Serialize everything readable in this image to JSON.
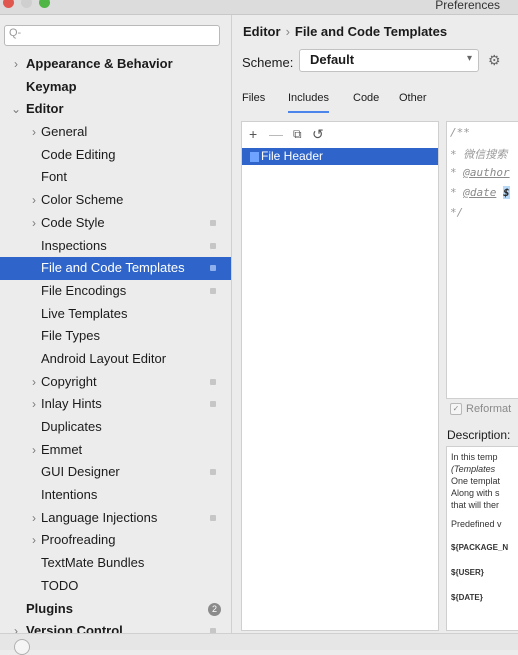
{
  "window": {
    "title": "Preferences"
  },
  "search": {
    "placeholder": "Q-"
  },
  "tree": [
    {
      "label": "Appearance & Behavior",
      "bold": true,
      "arrow": "›",
      "indent": 0
    },
    {
      "label": "Keymap",
      "bold": true,
      "arrow": "",
      "indent": 0
    },
    {
      "label": "Editor",
      "bold": true,
      "arrow": "⌄",
      "indent": 0
    },
    {
      "label": "General",
      "arrow": "›",
      "indent": 1
    },
    {
      "label": "Code Editing",
      "arrow": "",
      "indent": 1
    },
    {
      "label": "Font",
      "arrow": "",
      "indent": 1
    },
    {
      "label": "Color Scheme",
      "arrow": "›",
      "indent": 1
    },
    {
      "label": "Code Style",
      "arrow": "›",
      "indent": 1,
      "project": true
    },
    {
      "label": "Inspections",
      "arrow": "",
      "indent": 1,
      "project": true
    },
    {
      "label": "File and Code Templates",
      "arrow": "",
      "indent": 1,
      "project": true,
      "selected": true
    },
    {
      "label": "File Encodings",
      "arrow": "",
      "indent": 1,
      "project": true
    },
    {
      "label": "Live Templates",
      "arrow": "",
      "indent": 1
    },
    {
      "label": "File Types",
      "arrow": "",
      "indent": 1
    },
    {
      "label": "Android Layout Editor",
      "arrow": "",
      "indent": 1
    },
    {
      "label": "Copyright",
      "arrow": "›",
      "indent": 1,
      "project": true
    },
    {
      "label": "Inlay Hints",
      "arrow": "›",
      "indent": 1,
      "project": true
    },
    {
      "label": "Duplicates",
      "arrow": "",
      "indent": 1
    },
    {
      "label": "Emmet",
      "arrow": "›",
      "indent": 1
    },
    {
      "label": "GUI Designer",
      "arrow": "",
      "indent": 1,
      "project": true
    },
    {
      "label": "Intentions",
      "arrow": "",
      "indent": 1
    },
    {
      "label": "Language Injections",
      "arrow": "›",
      "indent": 1,
      "project": true
    },
    {
      "label": "Proofreading",
      "arrow": "›",
      "indent": 1
    },
    {
      "label": "TextMate Bundles",
      "arrow": "",
      "indent": 1
    },
    {
      "label": "TODO",
      "arrow": "",
      "indent": 1
    },
    {
      "label": "Plugins",
      "bold": true,
      "arrow": "",
      "indent": 0,
      "badge": "2"
    },
    {
      "label": "Version Control",
      "bold": true,
      "arrow": "›",
      "indent": 0,
      "project": true
    }
  ],
  "breadcrumb": {
    "part1": "Editor",
    "sep": "›",
    "part2": "File and Code Templates"
  },
  "scheme": {
    "label": "Scheme:",
    "value": "Default"
  },
  "tabs": [
    {
      "label": "Files"
    },
    {
      "label": "Includes",
      "active": true
    },
    {
      "label": "Code"
    },
    {
      "label": "Other"
    }
  ],
  "toolbar": {
    "add": "+",
    "remove": "—",
    "copy": "⧉",
    "reset": "↺"
  },
  "templates": [
    {
      "name": "File Header"
    }
  ],
  "editor": {
    "line1": "/**",
    "line2": "* 微信搜索",
    "line3_prefix": "* ",
    "line3_tag": "@author",
    "line4_prefix": "* ",
    "line4_tag": "@date",
    "line4_var": "$",
    "line5": "*/"
  },
  "reformat": {
    "label": "Reformat"
  },
  "description": {
    "label": "Description:",
    "lines": [
      "In this temp",
      "(Templates",
      "One templat",
      "Along with s",
      "that will ther"
    ],
    "predefined": "Predefined v",
    "vars": [
      "${PACKAGE_N",
      "${USER}",
      "${DATE}"
    ]
  }
}
